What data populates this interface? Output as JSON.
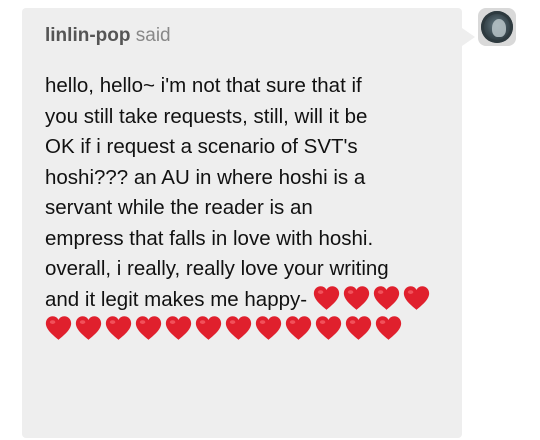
{
  "ask": {
    "asker_name": "linlin-pop",
    "asker_verb": " said",
    "question_text": "hello, hello~ i'm not that sure that if\nyou still take requests, still, will it be\nOK if i request a scenario of SVT's\nhoshi??? an AU in where hoshi is a\nservant while the reader is an\nempress that falls in love with hoshi.\noverall, i really, really love your writing\nand it legit makes me happy- ",
    "heart_count": 16,
    "heart_icon": "red-heart-icon",
    "colors": {
      "bubble_background": "#eeeeee",
      "asker_name": "#555555",
      "asker_verb": "#888888",
      "text": "#111111",
      "heart": "#e0202d"
    }
  },
  "avatar": {
    "icon": "avatar-image"
  }
}
